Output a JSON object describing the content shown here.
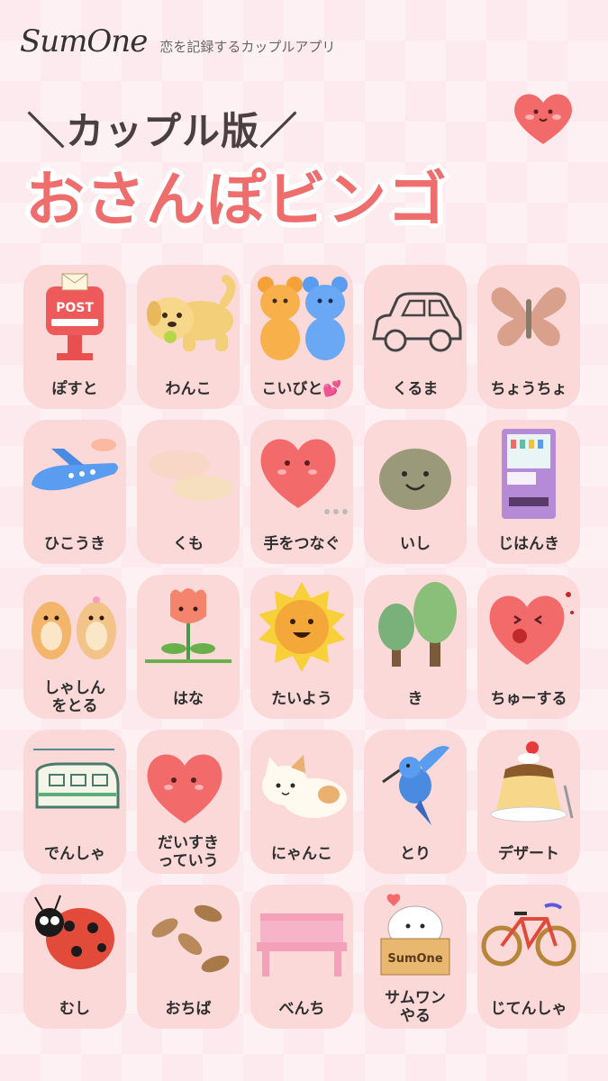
{
  "header": {
    "logo": "SumOne",
    "tagline": "恋を記録するカップルアプリ",
    "subtitle": "＼カップル版／",
    "title": "おさんぽビンゴ"
  },
  "bingo": [
    {
      "label": "ぽすと",
      "icon": "postbox-icon"
    },
    {
      "label": "わんこ",
      "icon": "dog-icon"
    },
    {
      "label": "こいびと💕",
      "icon": "gummy-bears-icon"
    },
    {
      "label": "くるま",
      "icon": "car-icon"
    },
    {
      "label": "ちょうちょ",
      "icon": "butterfly-icon"
    },
    {
      "label": "ひこうき",
      "icon": "airplane-icon"
    },
    {
      "label": "くも",
      "icon": "cloud-icon"
    },
    {
      "label": "手をつなぐ",
      "icon": "heart-holding-hands-icon"
    },
    {
      "label": "いし",
      "icon": "stone-icon"
    },
    {
      "label": "じはんき",
      "icon": "vending-machine-icon"
    },
    {
      "label": "しゃしん\nをとる",
      "icon": "hamsters-camera-icon"
    },
    {
      "label": "はな",
      "icon": "tulip-icon"
    },
    {
      "label": "たいよう",
      "icon": "sun-icon"
    },
    {
      "label": "き",
      "icon": "trees-icon"
    },
    {
      "label": "ちゅーする",
      "icon": "heart-kiss-icon"
    },
    {
      "label": "でんしゃ",
      "icon": "train-icon"
    },
    {
      "label": "だいすき\nっていう",
      "icon": "heart-speech-icon"
    },
    {
      "label": "にゃんこ",
      "icon": "cat-icon"
    },
    {
      "label": "とり",
      "icon": "bird-icon"
    },
    {
      "label": "デザート",
      "icon": "pudding-icon"
    },
    {
      "label": "むし",
      "icon": "ladybug-icon"
    },
    {
      "label": "おちば",
      "icon": "leaves-icon"
    },
    {
      "label": "べんち",
      "icon": "bench-icon"
    },
    {
      "label": "サムワン\nやる",
      "icon": "sumone-box-icon"
    },
    {
      "label": "じてんしゃ",
      "icon": "bicycle-icon"
    }
  ],
  "post_text": "POST",
  "box_text": "SumOne",
  "colors": {
    "background": "#fdeaee",
    "cell": "#fcd9d9",
    "title": "#ee6d6d",
    "subtitle": "#4a4040"
  }
}
